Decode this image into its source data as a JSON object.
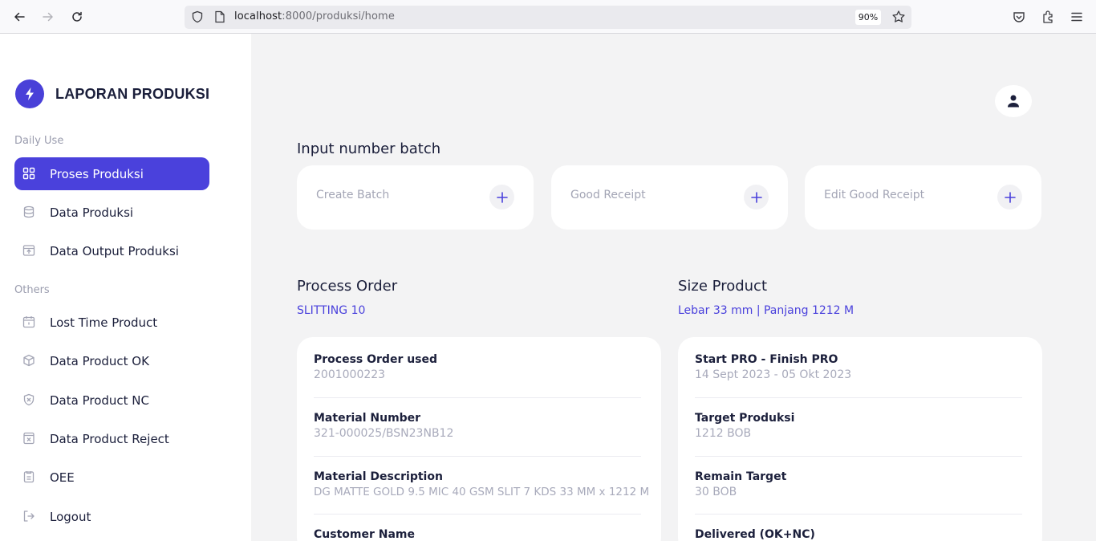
{
  "browser": {
    "url_host": "localhost",
    "url_path": ":8000/produksi/home",
    "zoom": "90%"
  },
  "sidebar": {
    "logo_text": "LAPORAN PRODUKSI",
    "section_daily": "Daily Use",
    "section_others": "Others",
    "items": [
      {
        "label": "Proses Produksi",
        "icon": "grid-icon",
        "active": true
      },
      {
        "label": "Data Produksi",
        "icon": "database-icon"
      },
      {
        "label": "Data Output Produksi",
        "icon": "upload-box-icon"
      },
      {
        "label": "Lost Time Product",
        "icon": "calendar-icon"
      },
      {
        "label": "Data Product OK",
        "icon": "box-icon"
      },
      {
        "label": "Data Product NC",
        "icon": "shield-x-icon"
      },
      {
        "label": "Data Product Reject",
        "icon": "x-box-icon"
      },
      {
        "label": "OEE",
        "icon": "clipboard-icon"
      },
      {
        "label": "Logout",
        "icon": "logout-icon"
      }
    ]
  },
  "main": {
    "batch_heading": "Input number batch",
    "batch_actions": [
      {
        "label": "Create Batch"
      },
      {
        "label": "Good Receipt"
      },
      {
        "label": "Edit Good Receipt"
      }
    ],
    "process_order": {
      "heading": "Process Order",
      "value": "SLITTING 10",
      "fields": [
        {
          "label": "Process Order used",
          "value": "2001000223"
        },
        {
          "label": "Material Number",
          "value": "321-000025/BSN23NB12"
        },
        {
          "label": "Material Description",
          "value": "DG MATTE GOLD 9.5 MIC 40 GSM SLIT 7 KDS 33 MM x 1212 M"
        },
        {
          "label": "Customer Name",
          "value": ""
        }
      ]
    },
    "size_product": {
      "heading": "Size Product",
      "value": "Lebar 33 mm | Panjang 1212 M",
      "fields": [
        {
          "label": "Start PRO - Finish PRO",
          "value": "14 Sept 2023 - 05 Okt 2023"
        },
        {
          "label": "Target Produksi",
          "value": "1212 BOB"
        },
        {
          "label": "Remain Target",
          "value": "30 BOB"
        },
        {
          "label": "Delivered (OK+NC)",
          "value": ""
        }
      ]
    }
  },
  "colors": {
    "accent": "#4a41dc",
    "sidebar_bg": "#ffffff",
    "main_bg": "#f3f3f4"
  }
}
